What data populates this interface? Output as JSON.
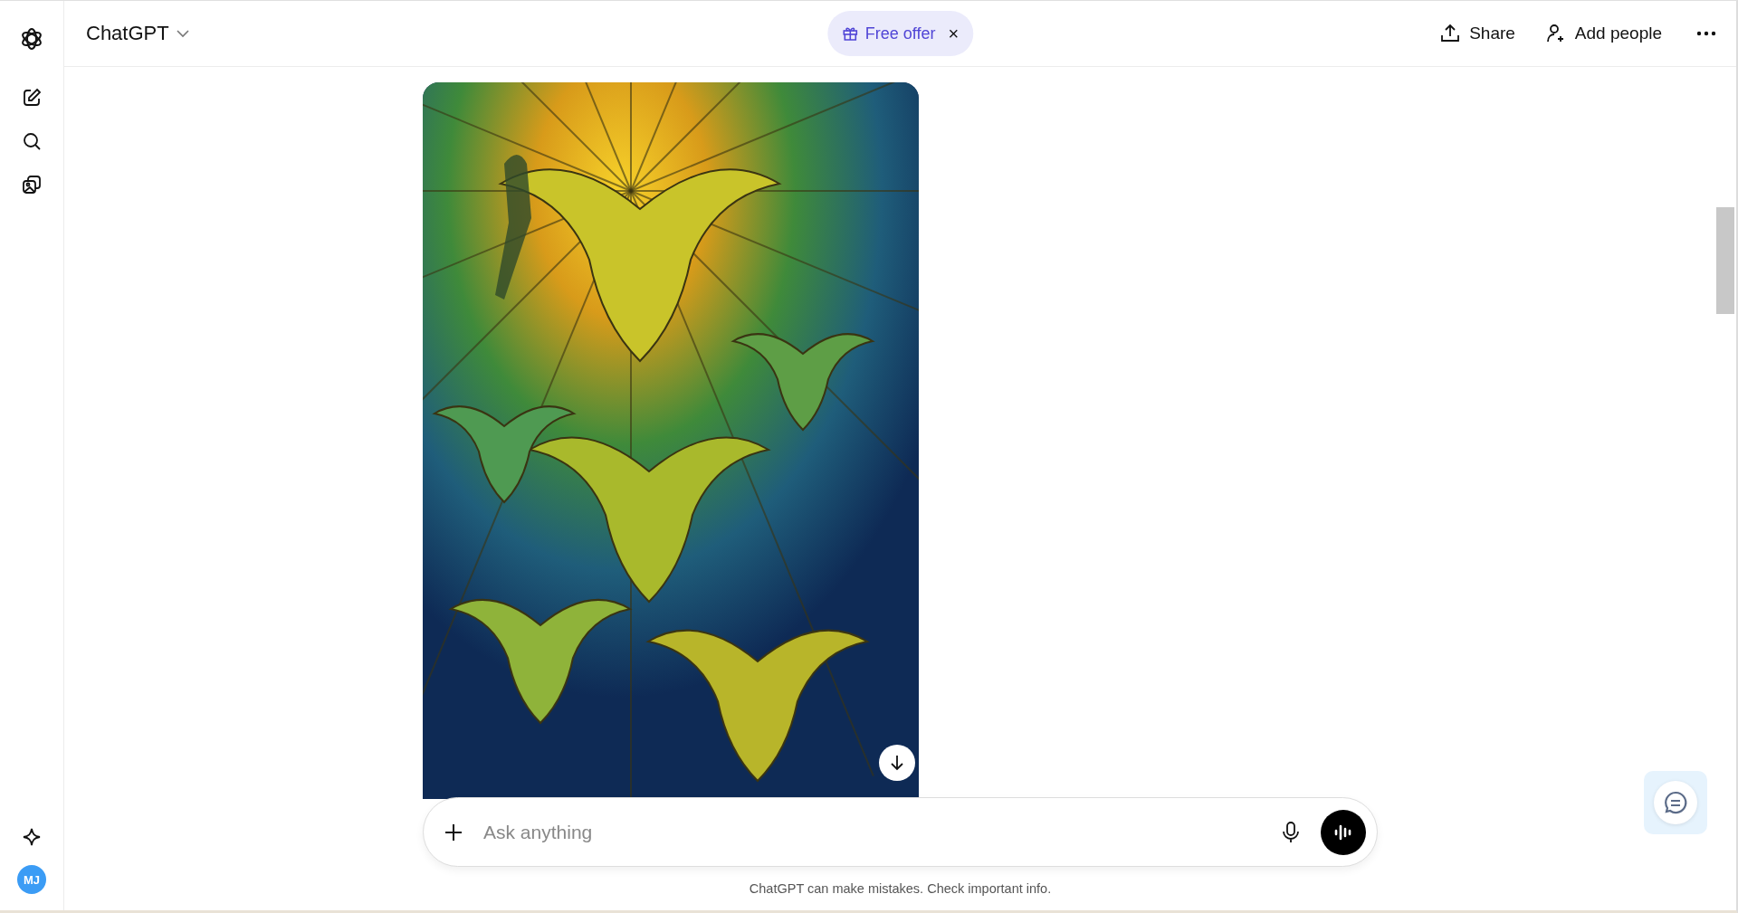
{
  "app": {
    "title": "ChatGPT"
  },
  "sidebar": {
    "avatar": "MJ"
  },
  "header": {
    "offer": "Free offer",
    "offer_close": "×",
    "actions": [
      "Share",
      "Add people"
    ]
  },
  "composer": {
    "placeholder": "Ask anything"
  },
  "disclaimer": "ChatGPT can make mistakes. Check important info."
}
